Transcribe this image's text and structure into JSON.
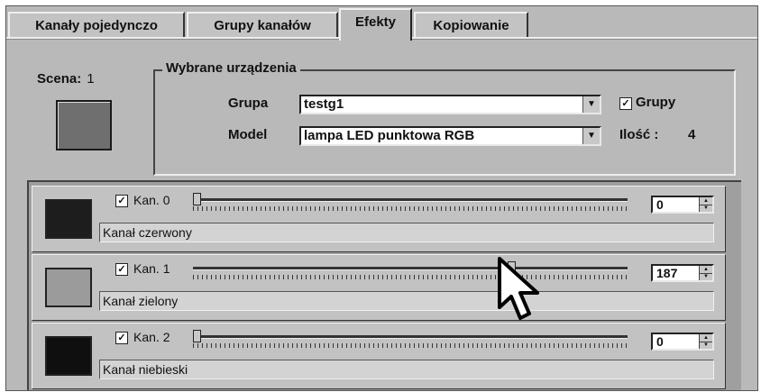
{
  "tabs": [
    {
      "label": "Kanały pojedynczo",
      "active": false
    },
    {
      "label": "Grupy kanałów",
      "active": false
    },
    {
      "label": "Efekty",
      "active": true
    },
    {
      "label": "Kopiowanie",
      "active": false
    }
  ],
  "scene": {
    "label": "Scena:",
    "value": "1",
    "color": "#6f6f6f"
  },
  "devices": {
    "legend": "Wybrane urządzenia",
    "group_label": "Grupa",
    "group_value": "testg1",
    "model_label": "Model",
    "model_value": "lampa LED punktowa RGB",
    "groups_checkbox_label": "Grupy",
    "groups_checked": true,
    "count_label": "Ilość :",
    "count_value": "4"
  },
  "channels": [
    {
      "check_label": "Kan. 0",
      "checked": true,
      "value": "0",
      "level": 0,
      "name": "Kanał czerwony",
      "color": "#1d1d1d"
    },
    {
      "check_label": "Kan. 1",
      "checked": true,
      "value": "187",
      "level": 0.733,
      "name": "Kanał zielony",
      "color": "#9b9b9b"
    },
    {
      "check_label": "Kan. 2",
      "checked": true,
      "value": "0",
      "level": 0,
      "name": "Kanał niebieski",
      "color": "#0f0f0f"
    }
  ],
  "icons": {
    "combo_arrow": "chevron-down-icon",
    "cursor": "mouse-pointer-icon"
  }
}
